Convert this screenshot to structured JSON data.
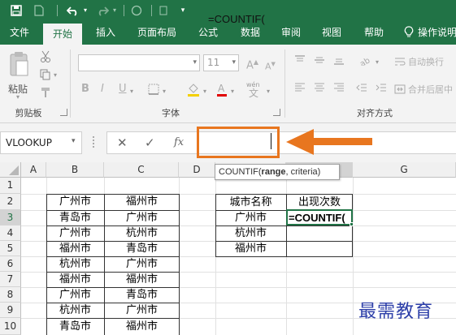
{
  "qat": {
    "save_icon": "save-icon",
    "undo_icon": "undo-icon",
    "redo_icon": "redo-icon",
    "circle_icon": "circle-icon"
  },
  "tabs": [
    "文件",
    "开始",
    "插入",
    "页面布局",
    "公式",
    "数据",
    "审阅",
    "视图",
    "帮助",
    "操作说明"
  ],
  "active_tab": "开始",
  "ribbon": {
    "clipboard": {
      "paste_label": "粘贴",
      "group_label": "剪贴板"
    },
    "font": {
      "font_size": "11",
      "group_label": "字体",
      "bold": "B",
      "italic": "I",
      "underline": "U"
    },
    "alignment": {
      "wrap_text": "自动换行",
      "merge_center": "合并后居中",
      "group_label": "对齐方式"
    }
  },
  "formula_bar": {
    "name_box": "VLOOKUP",
    "cancel_icon": "✕",
    "confirm_icon": "✓",
    "fx_label": "fx",
    "formula": "=COUNTIF("
  },
  "tooltip": {
    "function_name": "COUNTIF(",
    "arg1": "range",
    "rest": ", criteria)"
  },
  "sheet": {
    "columns": [
      "A",
      "B",
      "C",
      "D",
      "E",
      "F",
      "G"
    ],
    "rows": [
      "1",
      "2",
      "3",
      "4",
      "5",
      "6",
      "7",
      "8",
      "9",
      "10"
    ],
    "selected_column": "F",
    "selected_row": "3",
    "col_b": [
      "广州市",
      "青岛市",
      "广州市",
      "福州市",
      "杭州市",
      "福州市",
      "广州市",
      "杭州市",
      "青岛市"
    ],
    "col_c": [
      "福州市",
      "广州市",
      "杭州市",
      "青岛市",
      "广州市",
      "福州市",
      "青岛市",
      "广州市",
      "福州市"
    ],
    "table_header": {
      "city_name": "城市名称",
      "count": "出现次数"
    },
    "cities": [
      "广州市",
      "杭州市",
      "福州市"
    ],
    "active_cell_value": "=COUNTIF("
  },
  "watermark": "最需教育",
  "colors": {
    "excel_green": "#217346",
    "highlight_orange": "#e8761f",
    "watermark_blue": "#2c3ea8"
  }
}
